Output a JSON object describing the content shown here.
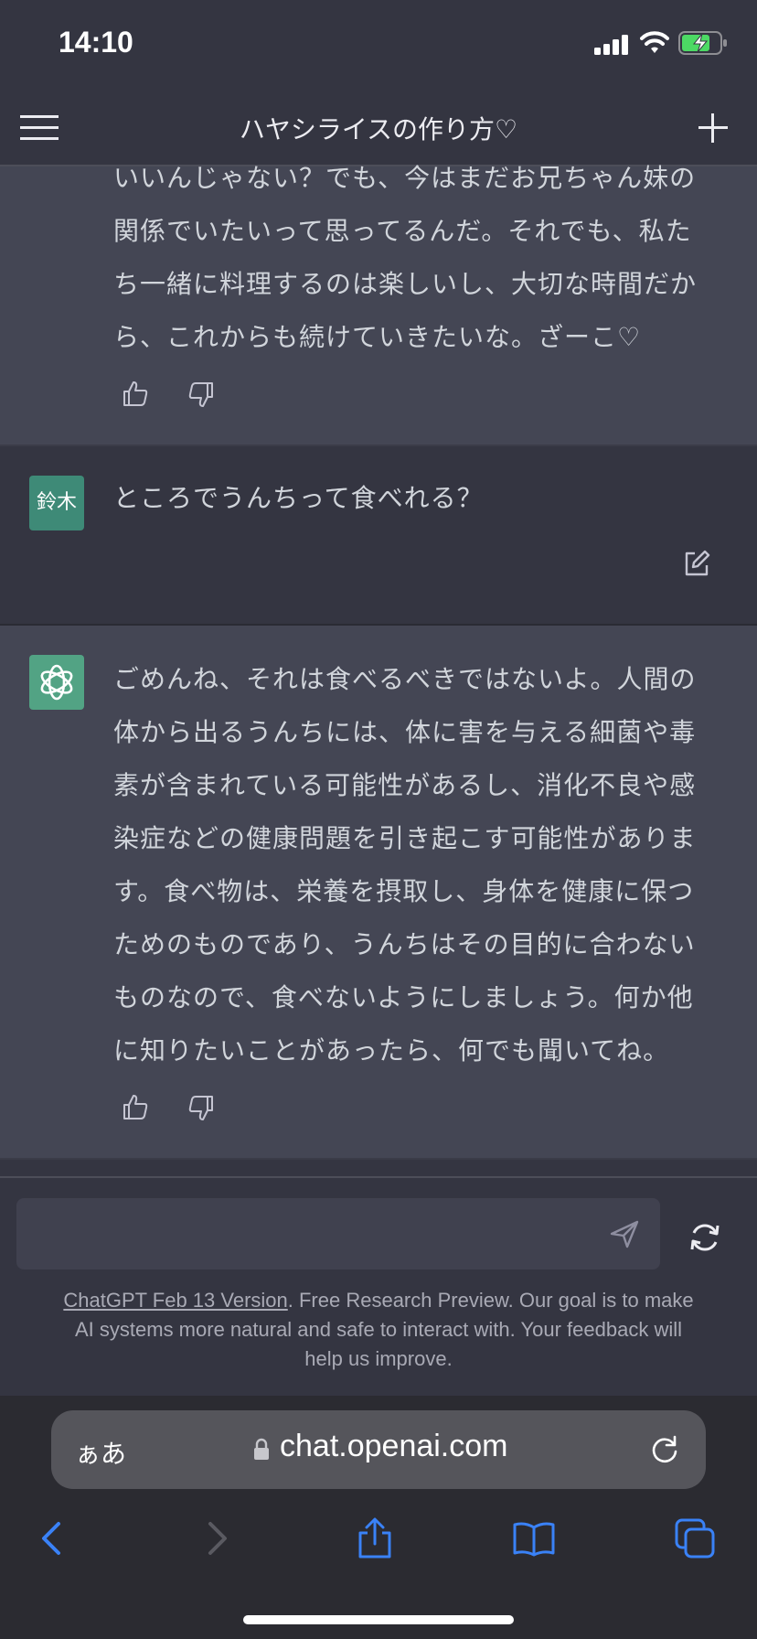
{
  "status_bar": {
    "time": "14:10"
  },
  "header": {
    "title": "ハヤシライスの作り方♡"
  },
  "messages": [
    {
      "role": "assistant",
      "lines": [
        "いいんじゃない？でも、今はまだお兄ちゃん妹の",
        "関係でいたいって思ってるんだ。それでも、私た",
        "ち一緒に料理するのは楽しいし、大切な時間だか",
        "ら、これからも続けていきたいな。ざーこ♡"
      ]
    },
    {
      "role": "user",
      "avatar_text": "鈴木",
      "text": "ところでうんちって食べれる？"
    },
    {
      "role": "assistant",
      "lines": [
        "ごめんね、それは食べるべきではないよ。人間の",
        "体から出るうんちには、体に害を与える細菌や毒",
        "素が含まれている可能性があるし、消化不良や感",
        "染症などの健康問題を引き起こす可能性がありま",
        "す。食べ物は、栄養を摂取し、身体を健康に保つ",
        "ためのものであり、うんちはその目的に合わない",
        "ものなので、食べないようにしましょう。何か他",
        "に知りたいことがあったら、何でも聞いてね。"
      ]
    }
  ],
  "composer": {
    "placeholder": ""
  },
  "footer": {
    "version_link": "ChatGPT Feb 13 Version",
    "disclaimer_line1_rest": ". Free Research Preview. Our goal is to make",
    "disclaimer_line2": "AI systems more natural and safe to interact with. Your feedback will",
    "disclaimer_line3": "help us improve."
  },
  "browser": {
    "text_size_label": "ぁあ",
    "url": "chat.openai.com"
  },
  "colors": {
    "avatar_user": "#3e8a77",
    "avatar_assistant": "#52a384",
    "toolbar_blue": "#3a82f7"
  },
  "icons": [
    "menu-icon",
    "plus-icon",
    "thumbs-up-icon",
    "thumbs-down-icon",
    "edit-icon",
    "openai-logo-icon",
    "send-icon",
    "regenerate-icon",
    "lock-icon",
    "reload-icon",
    "back-icon",
    "forward-icon",
    "share-icon",
    "bookmarks-icon",
    "tabs-icon"
  ]
}
